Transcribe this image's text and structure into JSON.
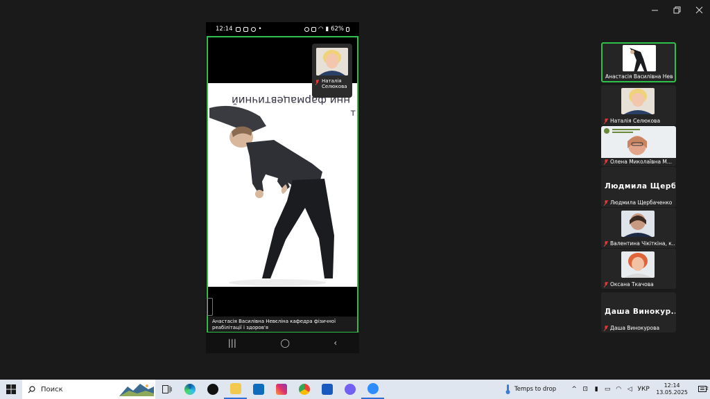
{
  "window": {
    "controls": [
      "minimize",
      "restore",
      "close"
    ]
  },
  "phone": {
    "status": {
      "time": "12:14",
      "battery": "62%"
    },
    "slide_text": "нни фармацевтичний",
    "slide_text2": "т",
    "pip": {
      "name_line1": "Наталія",
      "name_line2": "Селюкова"
    },
    "caption": "Анастасія Василівна Невєліна кафедра фізичної реабілітації і здоров'я",
    "nav": {
      "recent": "|||",
      "home": "◯",
      "back": "‹"
    }
  },
  "gallery": [
    {
      "name": "Анастасія Василівна Невеліна",
      "type": "video",
      "active": true
    },
    {
      "name": "Наталія Селюкова",
      "type": "video"
    },
    {
      "name": "Олена Миколаївна М...",
      "type": "video"
    },
    {
      "name": "Людмила Щербаченко",
      "big": "Людмила  Щерб...",
      "type": "name"
    },
    {
      "name": "Валентина Чікіткіна, к...",
      "type": "video"
    },
    {
      "name": "Оксана Ткачова",
      "type": "video"
    },
    {
      "name": "Даша Винокурова",
      "big": "Даша  Винокур...",
      "type": "name"
    }
  ],
  "taskbar": {
    "search_placeholder": "Поиск",
    "weather": "Temps to drop",
    "lang": "УКР",
    "time": "12:14",
    "date": "13.05.2025",
    "notifications": "2",
    "colors": {
      "zoom": "#2d8cff",
      "accent": "#2ec24a"
    }
  }
}
